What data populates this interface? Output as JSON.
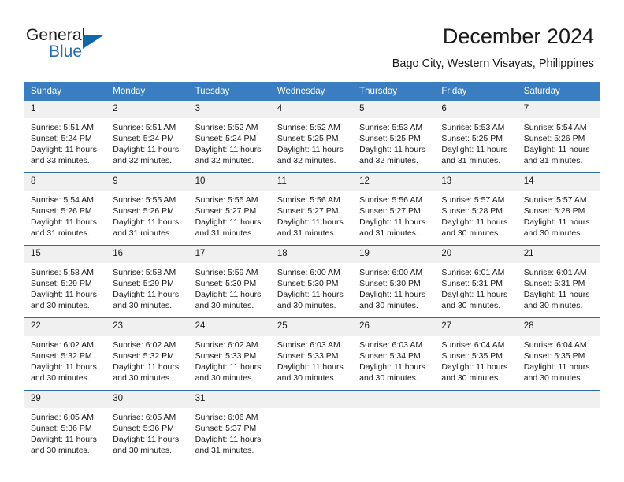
{
  "brand": {
    "word_general": "General",
    "word_blue": "Blue",
    "flag_color": "#1068ab"
  },
  "header": {
    "title": "December 2024",
    "location": "Bago City, Western Visayas, Philippines"
  },
  "theme": {
    "header_blue": "#3a7dc0",
    "row_divider_blue": "#2e6da4",
    "daynum_band": "#f0f0f0",
    "text": "#1a1a1a"
  },
  "calendar": {
    "weekday_headers": [
      "Sunday",
      "Monday",
      "Tuesday",
      "Wednesday",
      "Thursday",
      "Friday",
      "Saturday"
    ],
    "weeks": [
      [
        {
          "day": "1",
          "sunrise": "Sunrise: 5:51 AM",
          "sunset": "Sunset: 5:24 PM",
          "daylight_1": "Daylight: 11 hours",
          "daylight_2": "and 33 minutes."
        },
        {
          "day": "2",
          "sunrise": "Sunrise: 5:51 AM",
          "sunset": "Sunset: 5:24 PM",
          "daylight_1": "Daylight: 11 hours",
          "daylight_2": "and 32 minutes."
        },
        {
          "day": "3",
          "sunrise": "Sunrise: 5:52 AM",
          "sunset": "Sunset: 5:24 PM",
          "daylight_1": "Daylight: 11 hours",
          "daylight_2": "and 32 minutes."
        },
        {
          "day": "4",
          "sunrise": "Sunrise: 5:52 AM",
          "sunset": "Sunset: 5:25 PM",
          "daylight_1": "Daylight: 11 hours",
          "daylight_2": "and 32 minutes."
        },
        {
          "day": "5",
          "sunrise": "Sunrise: 5:53 AM",
          "sunset": "Sunset: 5:25 PM",
          "daylight_1": "Daylight: 11 hours",
          "daylight_2": "and 32 minutes."
        },
        {
          "day": "6",
          "sunrise": "Sunrise: 5:53 AM",
          "sunset": "Sunset: 5:25 PM",
          "daylight_1": "Daylight: 11 hours",
          "daylight_2": "and 31 minutes."
        },
        {
          "day": "7",
          "sunrise": "Sunrise: 5:54 AM",
          "sunset": "Sunset: 5:26 PM",
          "daylight_1": "Daylight: 11 hours",
          "daylight_2": "and 31 minutes."
        }
      ],
      [
        {
          "day": "8",
          "sunrise": "Sunrise: 5:54 AM",
          "sunset": "Sunset: 5:26 PM",
          "daylight_1": "Daylight: 11 hours",
          "daylight_2": "and 31 minutes."
        },
        {
          "day": "9",
          "sunrise": "Sunrise: 5:55 AM",
          "sunset": "Sunset: 5:26 PM",
          "daylight_1": "Daylight: 11 hours",
          "daylight_2": "and 31 minutes."
        },
        {
          "day": "10",
          "sunrise": "Sunrise: 5:55 AM",
          "sunset": "Sunset: 5:27 PM",
          "daylight_1": "Daylight: 11 hours",
          "daylight_2": "and 31 minutes."
        },
        {
          "day": "11",
          "sunrise": "Sunrise: 5:56 AM",
          "sunset": "Sunset: 5:27 PM",
          "daylight_1": "Daylight: 11 hours",
          "daylight_2": "and 31 minutes."
        },
        {
          "day": "12",
          "sunrise": "Sunrise: 5:56 AM",
          "sunset": "Sunset: 5:27 PM",
          "daylight_1": "Daylight: 11 hours",
          "daylight_2": "and 31 minutes."
        },
        {
          "day": "13",
          "sunrise": "Sunrise: 5:57 AM",
          "sunset": "Sunset: 5:28 PM",
          "daylight_1": "Daylight: 11 hours",
          "daylight_2": "and 30 minutes."
        },
        {
          "day": "14",
          "sunrise": "Sunrise: 5:57 AM",
          "sunset": "Sunset: 5:28 PM",
          "daylight_1": "Daylight: 11 hours",
          "daylight_2": "and 30 minutes."
        }
      ],
      [
        {
          "day": "15",
          "sunrise": "Sunrise: 5:58 AM",
          "sunset": "Sunset: 5:29 PM",
          "daylight_1": "Daylight: 11 hours",
          "daylight_2": "and 30 minutes."
        },
        {
          "day": "16",
          "sunrise": "Sunrise: 5:58 AM",
          "sunset": "Sunset: 5:29 PM",
          "daylight_1": "Daylight: 11 hours",
          "daylight_2": "and 30 minutes."
        },
        {
          "day": "17",
          "sunrise": "Sunrise: 5:59 AM",
          "sunset": "Sunset: 5:30 PM",
          "daylight_1": "Daylight: 11 hours",
          "daylight_2": "and 30 minutes."
        },
        {
          "day": "18",
          "sunrise": "Sunrise: 6:00 AM",
          "sunset": "Sunset: 5:30 PM",
          "daylight_1": "Daylight: 11 hours",
          "daylight_2": "and 30 minutes."
        },
        {
          "day": "19",
          "sunrise": "Sunrise: 6:00 AM",
          "sunset": "Sunset: 5:30 PM",
          "daylight_1": "Daylight: 11 hours",
          "daylight_2": "and 30 minutes."
        },
        {
          "day": "20",
          "sunrise": "Sunrise: 6:01 AM",
          "sunset": "Sunset: 5:31 PM",
          "daylight_1": "Daylight: 11 hours",
          "daylight_2": "and 30 minutes."
        },
        {
          "day": "21",
          "sunrise": "Sunrise: 6:01 AM",
          "sunset": "Sunset: 5:31 PM",
          "daylight_1": "Daylight: 11 hours",
          "daylight_2": "and 30 minutes."
        }
      ],
      [
        {
          "day": "22",
          "sunrise": "Sunrise: 6:02 AM",
          "sunset": "Sunset: 5:32 PM",
          "daylight_1": "Daylight: 11 hours",
          "daylight_2": "and 30 minutes."
        },
        {
          "day": "23",
          "sunrise": "Sunrise: 6:02 AM",
          "sunset": "Sunset: 5:32 PM",
          "daylight_1": "Daylight: 11 hours",
          "daylight_2": "and 30 minutes."
        },
        {
          "day": "24",
          "sunrise": "Sunrise: 6:02 AM",
          "sunset": "Sunset: 5:33 PM",
          "daylight_1": "Daylight: 11 hours",
          "daylight_2": "and 30 minutes."
        },
        {
          "day": "25",
          "sunrise": "Sunrise: 6:03 AM",
          "sunset": "Sunset: 5:33 PM",
          "daylight_1": "Daylight: 11 hours",
          "daylight_2": "and 30 minutes."
        },
        {
          "day": "26",
          "sunrise": "Sunrise: 6:03 AM",
          "sunset": "Sunset: 5:34 PM",
          "daylight_1": "Daylight: 11 hours",
          "daylight_2": "and 30 minutes."
        },
        {
          "day": "27",
          "sunrise": "Sunrise: 6:04 AM",
          "sunset": "Sunset: 5:35 PM",
          "daylight_1": "Daylight: 11 hours",
          "daylight_2": "and 30 minutes."
        },
        {
          "day": "28",
          "sunrise": "Sunrise: 6:04 AM",
          "sunset": "Sunset: 5:35 PM",
          "daylight_1": "Daylight: 11 hours",
          "daylight_2": "and 30 minutes."
        }
      ],
      [
        {
          "day": "29",
          "sunrise": "Sunrise: 6:05 AM",
          "sunset": "Sunset: 5:36 PM",
          "daylight_1": "Daylight: 11 hours",
          "daylight_2": "and 30 minutes."
        },
        {
          "day": "30",
          "sunrise": "Sunrise: 6:05 AM",
          "sunset": "Sunset: 5:36 PM",
          "daylight_1": "Daylight: 11 hours",
          "daylight_2": "and 30 minutes."
        },
        {
          "day": "31",
          "sunrise": "Sunrise: 6:06 AM",
          "sunset": "Sunset: 5:37 PM",
          "daylight_1": "Daylight: 11 hours",
          "daylight_2": "and 31 minutes."
        },
        {
          "day": "",
          "sunrise": "",
          "sunset": "",
          "daylight_1": "",
          "daylight_2": ""
        },
        {
          "day": "",
          "sunrise": "",
          "sunset": "",
          "daylight_1": "",
          "daylight_2": ""
        },
        {
          "day": "",
          "sunrise": "",
          "sunset": "",
          "daylight_1": "",
          "daylight_2": ""
        },
        {
          "day": "",
          "sunrise": "",
          "sunset": "",
          "daylight_1": "",
          "daylight_2": ""
        }
      ]
    ]
  }
}
